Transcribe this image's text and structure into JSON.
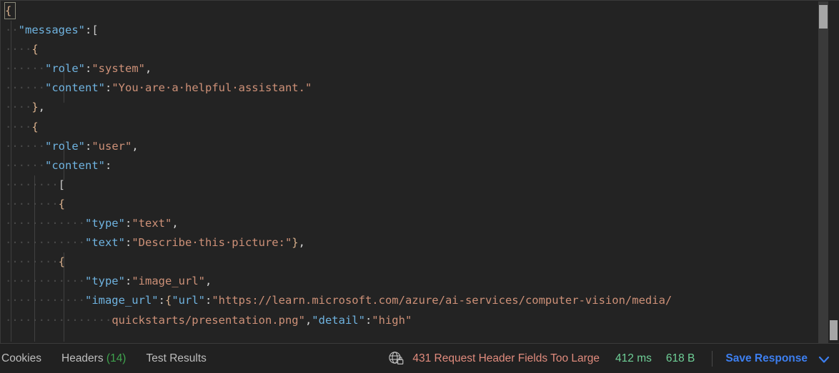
{
  "editor": {
    "language": "json",
    "background_color": "#232323",
    "key_color": "#6fb3e0",
    "string_color": "#ce9178",
    "lines": [
      {
        "indent": 0,
        "tokens": [
          {
            "t": "{",
            "c": "brace"
          }
        ]
      },
      {
        "indent": 1,
        "tokens": [
          {
            "t": "\"messages\"",
            "c": "key"
          },
          {
            "t": ":",
            "c": "punct"
          },
          {
            "t": "[",
            "c": "bracket"
          }
        ]
      },
      {
        "indent": 2,
        "tokens": [
          {
            "t": "{",
            "c": "brace"
          }
        ]
      },
      {
        "indent": 3,
        "tokens": [
          {
            "t": "\"role\"",
            "c": "key"
          },
          {
            "t": ":",
            "c": "punct"
          },
          {
            "t": "\"system\"",
            "c": "string"
          },
          {
            "t": ",",
            "c": "punct"
          }
        ]
      },
      {
        "indent": 3,
        "tokens": [
          {
            "t": "\"content\"",
            "c": "key"
          },
          {
            "t": ":",
            "c": "punct"
          },
          {
            "t": "\"You are a helpful assistant.\"",
            "c": "string"
          }
        ]
      },
      {
        "indent": 2,
        "tokens": [
          {
            "t": "}",
            "c": "brace"
          },
          {
            "t": ",",
            "c": "punct"
          }
        ]
      },
      {
        "indent": 2,
        "tokens": [
          {
            "t": "{",
            "c": "brace"
          }
        ]
      },
      {
        "indent": 3,
        "tokens": [
          {
            "t": "\"role\"",
            "c": "key"
          },
          {
            "t": ":",
            "c": "punct"
          },
          {
            "t": "\"user\"",
            "c": "string"
          },
          {
            "t": ",",
            "c": "punct"
          }
        ]
      },
      {
        "indent": 3,
        "tokens": [
          {
            "t": "\"content\"",
            "c": "key"
          },
          {
            "t": ":",
            "c": "punct"
          }
        ]
      },
      {
        "indent": 4,
        "tokens": [
          {
            "t": "[",
            "c": "bracket"
          }
        ]
      },
      {
        "indent": 4,
        "tokens": [
          {
            "t": "{",
            "c": "brace"
          }
        ]
      },
      {
        "indent": 6,
        "tokens": [
          {
            "t": "\"type\"",
            "c": "key"
          },
          {
            "t": ":",
            "c": "punct"
          },
          {
            "t": "\"text\"",
            "c": "string"
          },
          {
            "t": ",",
            "c": "punct"
          }
        ]
      },
      {
        "indent": 6,
        "tokens": [
          {
            "t": "\"text\"",
            "c": "key"
          },
          {
            "t": ":",
            "c": "punct"
          },
          {
            "t": "\"Describe this picture:\"",
            "c": "string"
          },
          {
            "t": "}",
            "c": "brace"
          },
          {
            "t": ",",
            "c": "punct"
          }
        ]
      },
      {
        "indent": 4,
        "tokens": [
          {
            "t": "{",
            "c": "brace"
          }
        ]
      },
      {
        "indent": 6,
        "tokens": [
          {
            "t": "\"type\"",
            "c": "key"
          },
          {
            "t": ":",
            "c": "punct"
          },
          {
            "t": "\"image_url\"",
            "c": "string"
          },
          {
            "t": ",",
            "c": "punct"
          }
        ]
      },
      {
        "indent": 6,
        "tokens": [
          {
            "t": "\"image_url\"",
            "c": "key"
          },
          {
            "t": ":",
            "c": "punct"
          },
          {
            "t": "{",
            "c": "brace"
          },
          {
            "t": "\"url\"",
            "c": "key"
          },
          {
            "t": ":",
            "c": "punct"
          },
          {
            "t": "\"https://learn.microsoft.com/azure/ai-services/computer-vision/media/",
            "c": "string"
          }
        ]
      },
      {
        "indent": 8,
        "tokens": [
          {
            "t": "quickstarts/presentation.png\"",
            "c": "string"
          },
          {
            "t": ",",
            "c": "punct"
          },
          {
            "t": "\"detail\"",
            "c": "key"
          },
          {
            "t": ":",
            "c": "punct"
          },
          {
            "t": "\"high\"",
            "c": "string"
          }
        ]
      }
    ]
  },
  "statusbar": {
    "tabs": [
      {
        "label": "Cookies",
        "count": null,
        "truncated": true
      },
      {
        "label": "Headers",
        "count": "(14)",
        "truncated": false
      },
      {
        "label": "Test Results",
        "count": null,
        "truncated": false
      }
    ],
    "security_icon": "globe-lock-icon",
    "status_code": "431 Request Header Fields Too Large",
    "status_color": "#e08b7d",
    "time": "412 ms",
    "size": "618 B",
    "metric_color": "#6fcf97",
    "save_response_label": "Save Response",
    "save_response_color": "#3d7ff0",
    "chevron_icon": "chevron-down-icon"
  }
}
